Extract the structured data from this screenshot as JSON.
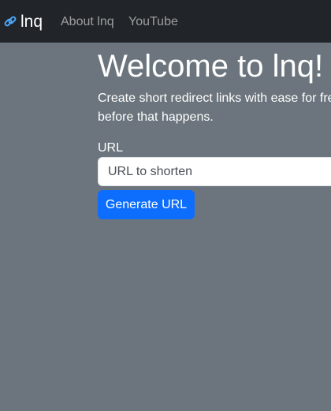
{
  "navbar": {
    "brand_icon": "link-icon",
    "brand": "lnq",
    "links": [
      "About lnq",
      "YouTube"
    ]
  },
  "main": {
    "title": "Welcome to lnq!",
    "lead": "Create short redirect links with ease for fre will be notified before that happens.",
    "url_label": "URL",
    "url_placeholder": "URL to shorten",
    "url_value": "",
    "button_label": "Generate URL"
  },
  "colors": {
    "navbar_bg": "#212529",
    "page_bg": "#6c757d",
    "primary": "#0d6efd",
    "link_icon": "#4aa8ff"
  }
}
